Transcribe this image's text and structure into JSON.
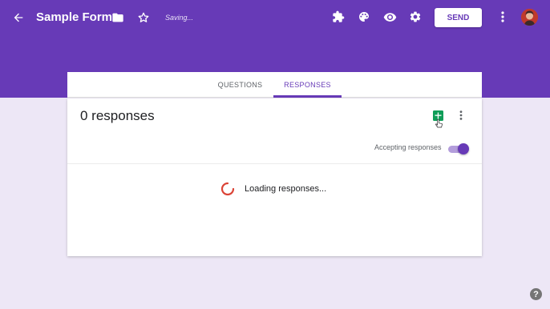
{
  "header": {
    "title": "Sample Form",
    "saving_status": "Saving...",
    "send_label": "SEND",
    "accent_color": "#673ab7",
    "icons": [
      "back-arrow-icon",
      "folder-icon",
      "star-icon",
      "addon-puzzle-icon",
      "palette-icon",
      "eye-icon",
      "gear-icon",
      "more-vert-icon"
    ]
  },
  "tabs": [
    {
      "label": "QUESTIONS",
      "active": false
    },
    {
      "label": "RESPONSES",
      "active": true
    }
  ],
  "responses": {
    "count_text": "0 responses",
    "accepting_label": "Accepting responses",
    "accepting_enabled": true,
    "loading_text": "Loading responses...",
    "sheets_color": "#0f9d58"
  },
  "help": {
    "label": "?"
  }
}
